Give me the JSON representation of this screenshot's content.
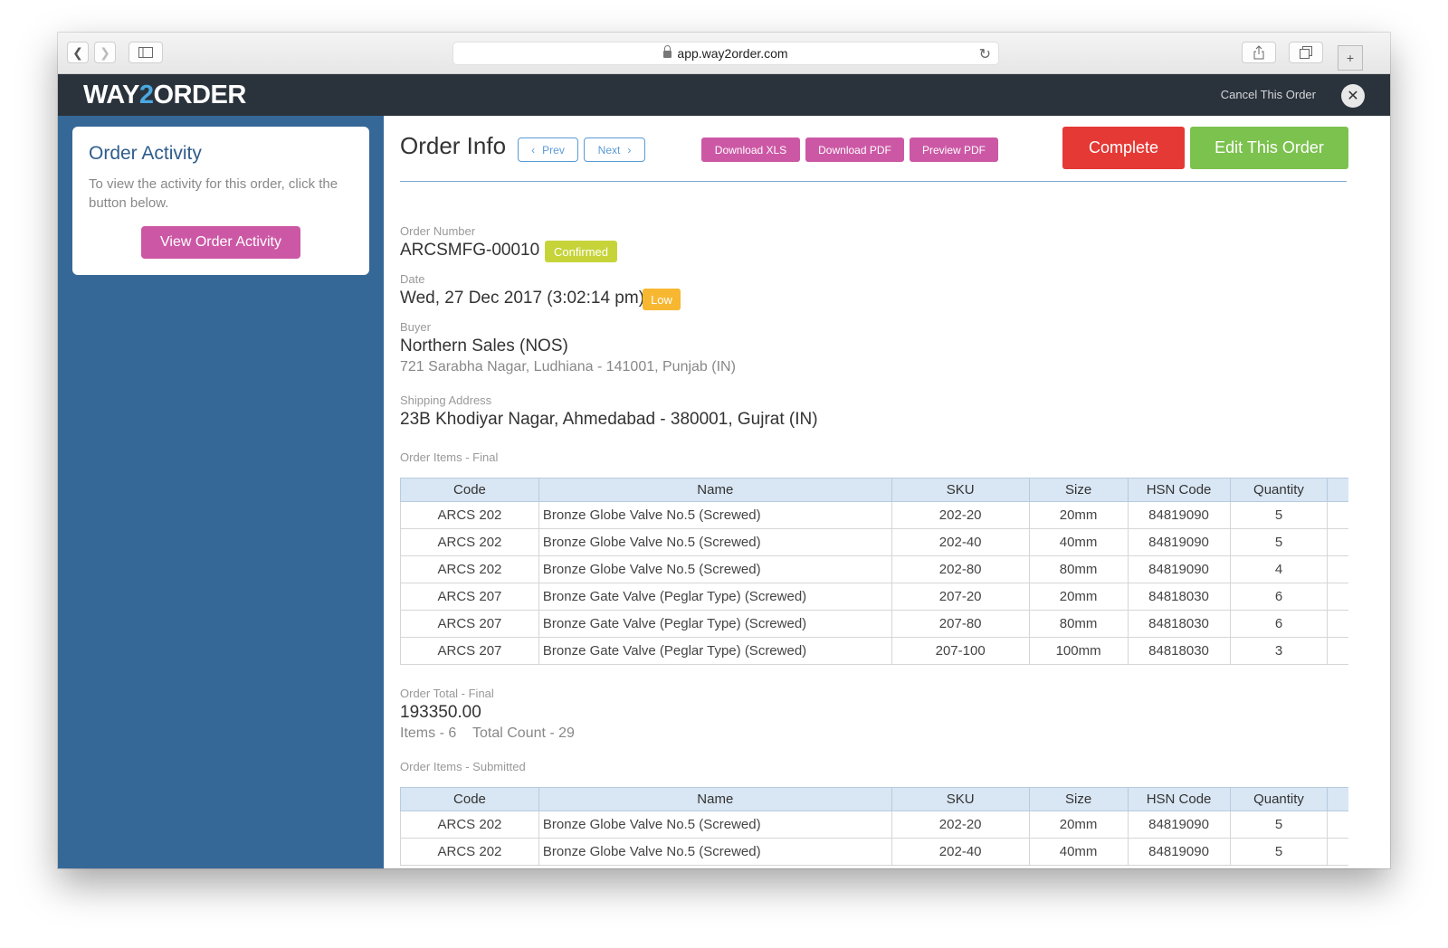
{
  "browser": {
    "url": "app.way2order.com"
  },
  "header": {
    "logo_a": "WAY",
    "logo_b": "2",
    "logo_c": "ORDER",
    "cancel_label": "Cancel This Order"
  },
  "sidebar": {
    "card_title": "Order Activity",
    "card_text": "To view the activity for this order, click the button below.",
    "button_label": "View Order Activity"
  },
  "toolbar": {
    "title": "Order Info",
    "prev_label": "Prev",
    "next_label": "Next",
    "download_xls": "Download XLS",
    "download_pdf": "Download PDF",
    "preview_pdf": "Preview PDF",
    "complete_label": "Complete",
    "edit_label": "Edit This Order"
  },
  "order": {
    "number_label": "Order Number",
    "number": "ARCSMFG-00010",
    "status": "Confirmed",
    "date_label": "Date",
    "date": "Wed, 27 Dec 2017 (3:02:14 pm)",
    "priority": "Low",
    "buyer_label": "Buyer",
    "buyer_name": "Northern Sales (NOS)",
    "buyer_address": "721 Sarabha Nagar, Ludhiana - 141001, Punjab (IN)",
    "shipping_label": "Shipping Address",
    "shipping_address": "23B Khodiyar Nagar, Ahmedabad - 380001, Gujrat (IN)",
    "final_items_label": "Order Items - Final",
    "total_label": "Order Total - Final",
    "total": "193350.00",
    "items_count": "Items - 6",
    "total_count": "Total Count - 29",
    "submitted_items_label": "Order Items - Submitted"
  },
  "columns": [
    "Code",
    "Name",
    "SKU",
    "Size",
    "HSN Code",
    "Quantity"
  ],
  "final_items": [
    {
      "code": "ARCS 202",
      "name": "Bronze Globe Valve No.5 (Screwed)",
      "sku": "202-20",
      "size": "20mm",
      "hsn": "84819090",
      "qty": "5"
    },
    {
      "code": "ARCS 202",
      "name": "Bronze Globe Valve No.5 (Screwed)",
      "sku": "202-40",
      "size": "40mm",
      "hsn": "84819090",
      "qty": "5"
    },
    {
      "code": "ARCS 202",
      "name": "Bronze Globe Valve No.5 (Screwed)",
      "sku": "202-80",
      "size": "80mm",
      "hsn": "84819090",
      "qty": "4"
    },
    {
      "code": "ARCS 207",
      "name": "Bronze Gate Valve (Peglar Type) (Screwed)",
      "sku": "207-20",
      "size": "20mm",
      "hsn": "84818030",
      "qty": "6"
    },
    {
      "code": "ARCS 207",
      "name": "Bronze Gate Valve (Peglar Type) (Screwed)",
      "sku": "207-80",
      "size": "80mm",
      "hsn": "84818030",
      "qty": "6"
    },
    {
      "code": "ARCS 207",
      "name": "Bronze Gate Valve (Peglar Type) (Screwed)",
      "sku": "207-100",
      "size": "100mm",
      "hsn": "84818030",
      "qty": "3"
    }
  ],
  "submitted_items": [
    {
      "code": "ARCS 202",
      "name": "Bronze Globe Valve No.5 (Screwed)",
      "sku": "202-20",
      "size": "20mm",
      "hsn": "84819090",
      "qty": "5"
    },
    {
      "code": "ARCS 202",
      "name": "Bronze Globe Valve No.5 (Screwed)",
      "sku": "202-40",
      "size": "40mm",
      "hsn": "84819090",
      "qty": "5"
    }
  ],
  "colors": {
    "sidebar_bg": "#366897",
    "header_bg": "#2a333c",
    "pink": "#cc58a5",
    "complete_red": "#e53935",
    "edit_green": "#7cc24e",
    "confirmed_badge": "#c6d43a",
    "low_badge": "#f7b731"
  }
}
